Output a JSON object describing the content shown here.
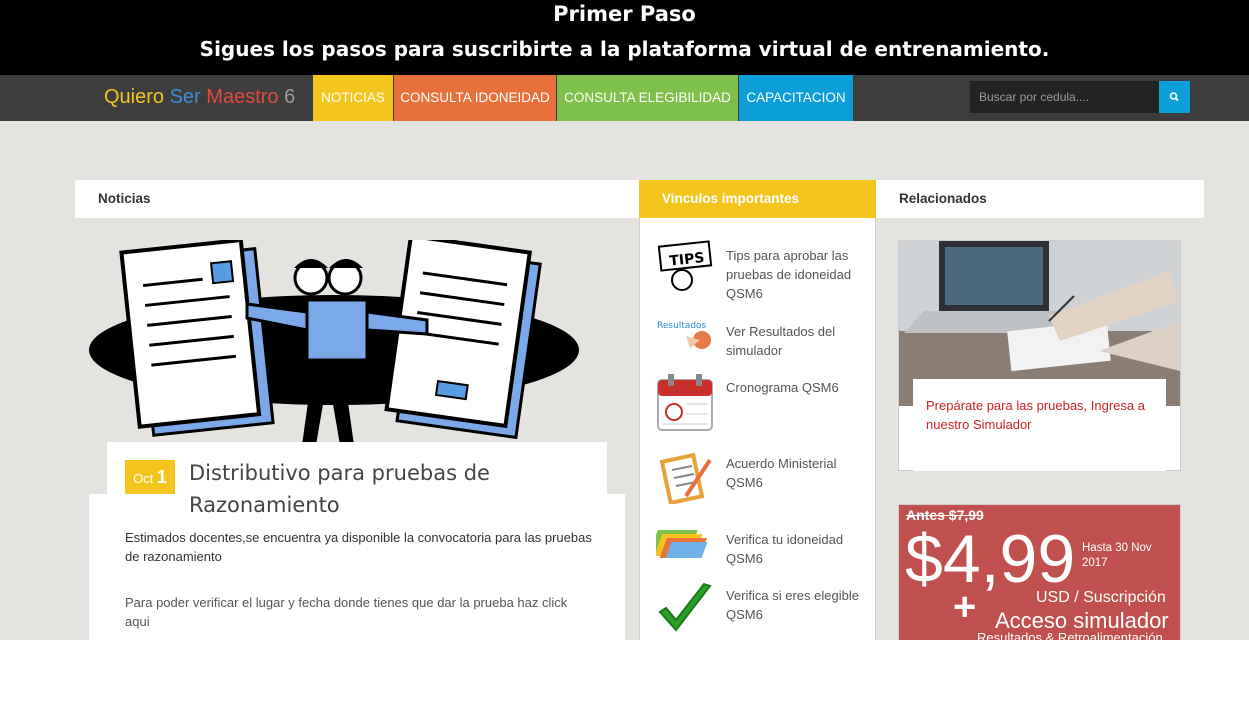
{
  "banner": {
    "line1": "Primer Paso",
    "line2": "Sigues los pasos para suscribirte a la plataforma virtual de entrenamiento."
  },
  "nav": {
    "brand": {
      "w1": "Quiero",
      "w2": "Ser",
      "w3": "Maestro",
      "w4": "6"
    },
    "tabs": [
      {
        "label": "NOTICIAS",
        "color": "#f4c51c"
      },
      {
        "label": "CONSULTA IDONEIDAD",
        "color": "#e8703a"
      },
      {
        "label": "CONSULTA ELEGIBILIDAD",
        "color": "#7ec04a"
      },
      {
        "label": "CAPACITACION",
        "color": "#0c9ed6"
      }
    ],
    "search_placeholder": "Buscar por cedula...."
  },
  "news": {
    "header": "Noticias",
    "date_month": "Oct",
    "date_day": "1",
    "title": "Distributivo para pruebas de Razonamiento",
    "p1": "Estimados docentes,se encuentra ya disponible la convocatoria para las pruebas de razonamiento",
    "p2": "Para poder verificar el lugar y fecha donde tienes que dar la prueba haz click aqui"
  },
  "links": {
    "header": "Vinculos importantes",
    "items": [
      {
        "label": "Tips para aprobar las pruebas de idoneidad QSM6",
        "icon": "tips-icon"
      },
      {
        "label": "Ver Resultados del simulador",
        "icon": "results-icon"
      },
      {
        "label": "Cronograma QSM6",
        "icon": "calendar-icon"
      },
      {
        "label": "Acuerdo Ministerial QSM6",
        "icon": "clipboard-icon"
      },
      {
        "label": "Verifica tu idoneidad QSM6",
        "icon": "folders-icon"
      },
      {
        "label": "Verifica si eres elegible QSM6",
        "icon": "checkmark-icon"
      }
    ],
    "tips_text": "TIPS",
    "results_text": "Resultados"
  },
  "related": {
    "header": "Relacionados",
    "card_text": "Prepárate para las pruebas, Ingresa a nuestro Simulador"
  },
  "promo": {
    "old_price": "Antes $7,99",
    "price": "$4,99",
    "until": "Hasta 30 Nov 2017",
    "unit": "USD / Suscripción",
    "plus": "+",
    "access": "Acceso simulador",
    "extra": "Resultados & Retroalimentación"
  },
  "colors": {
    "accent_yellow": "#f4c51c",
    "accent_orange": "#e8703a",
    "accent_green": "#7ec04a",
    "accent_blue": "#0c9ed6",
    "promo_red": "#c0504d",
    "link_red": "#cc2222"
  }
}
